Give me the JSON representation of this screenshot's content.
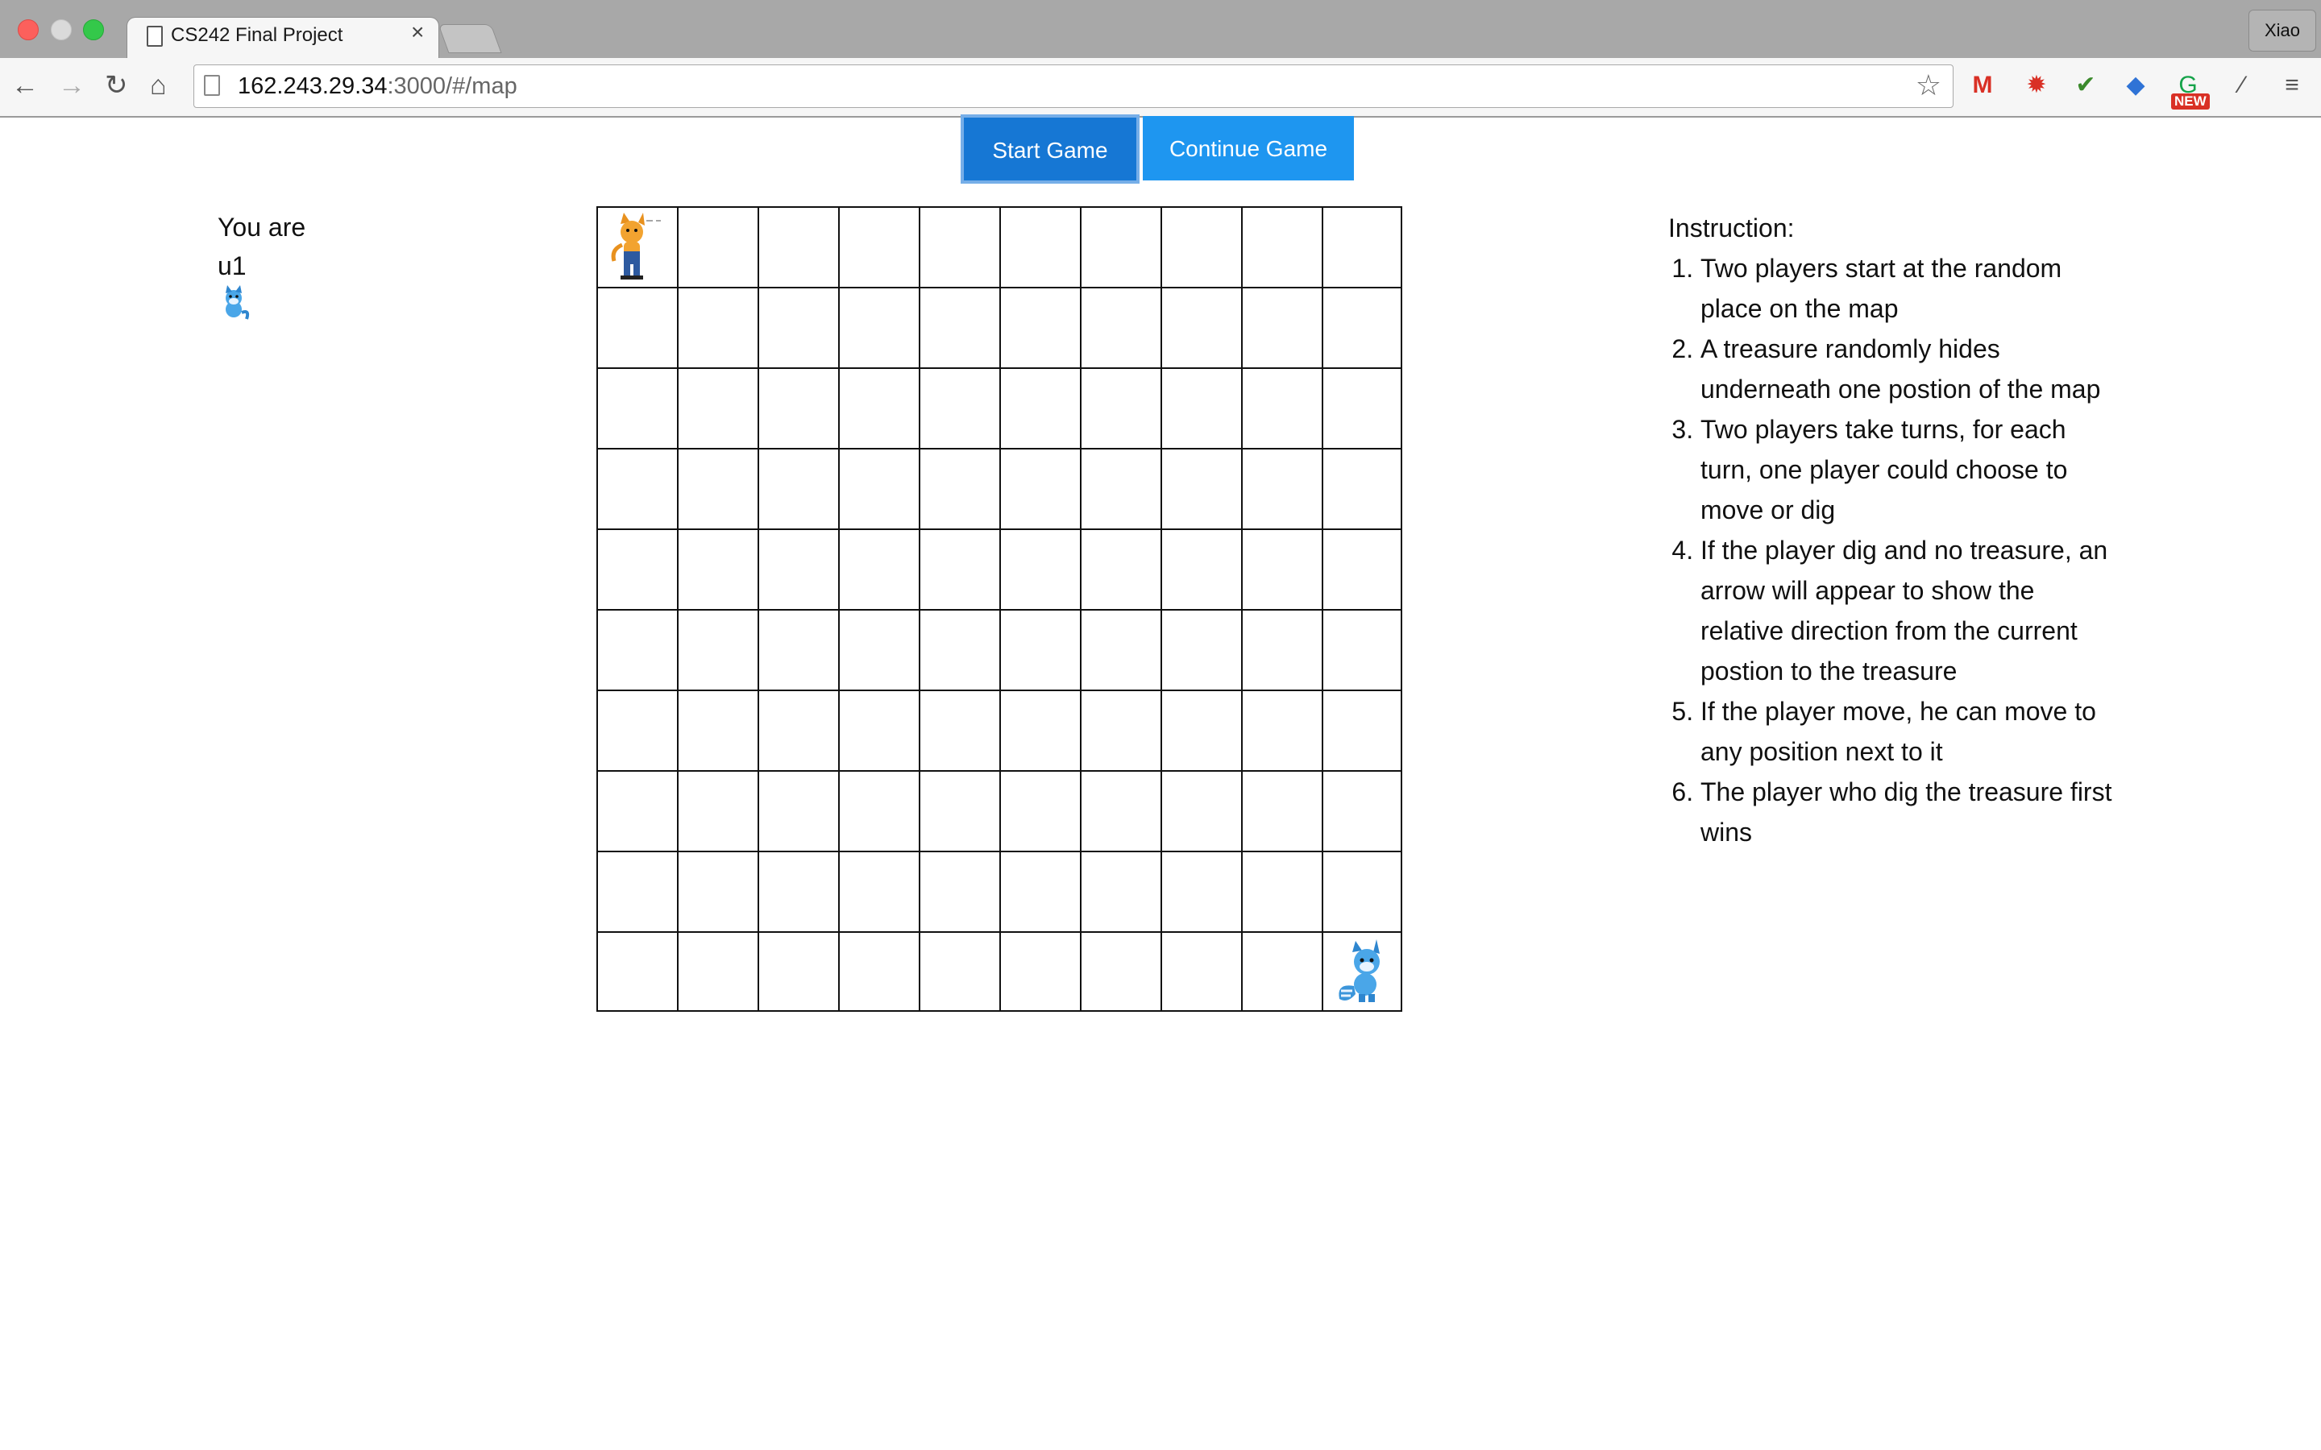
{
  "browser": {
    "tab_title": "CS242 Final Project",
    "tab_close": "×",
    "profile_name": "Xiao",
    "url_host": "162.243.29.34",
    "url_rest": ":3000/#/map",
    "extensions": [
      "gmail-icon",
      "star-burst-icon",
      "check-icon",
      "graduation-cap-icon",
      "grammarly-icon",
      "wand-icon"
    ],
    "new_badge": "NEW"
  },
  "buttons": {
    "start": "Start Game",
    "continue": "Continue Game"
  },
  "player": {
    "label": "You are",
    "name": "u1",
    "avatar": "blue-fox-icon"
  },
  "map": {
    "rows": 10,
    "cols": 10,
    "pieces": [
      {
        "row": 1,
        "col": 1,
        "icon": "orange-cat-player-icon"
      },
      {
        "row": 10,
        "col": 10,
        "icon": "blue-fox-player-icon"
      }
    ]
  },
  "instructions": {
    "heading": "Instruction:",
    "items": [
      "Two players start at the random place on the map",
      "A treasure randomly hides underneath one postion of the map",
      "Two players take turns, for each turn, one player could choose to move or dig",
      "If the player dig and no treasure, an arrow will appear to show the relative direction from the current postion to the treasure",
      "If the player move, he can move to any position next to it",
      "The player who dig the treasure first wins"
    ]
  },
  "colors": {
    "start_button": "#1677d4",
    "continue_button": "#1e96f0",
    "grid_line": "#111111"
  }
}
